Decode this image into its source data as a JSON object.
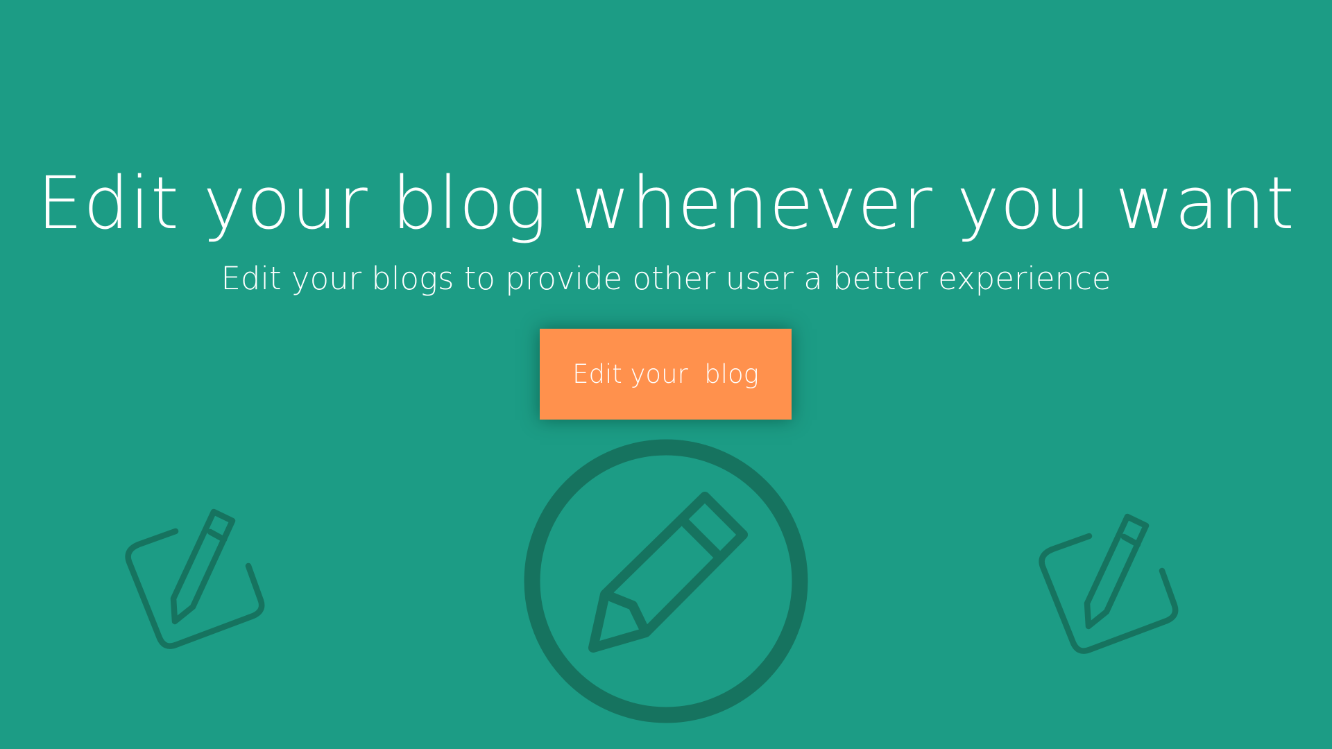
{
  "hero": {
    "title": "Edit your blog whenever you want",
    "subtitle": "Edit your blogs to provide other user a better experience",
    "cta_label": "Edit your  blog"
  },
  "icons": [
    "edit-note-icon",
    "pencil-circle-icon",
    "edit-note-icon"
  ],
  "colors": {
    "background": "#1c9c85",
    "accent": "#ff914d",
    "icon": "#16735f",
    "text": "#ffffff"
  }
}
